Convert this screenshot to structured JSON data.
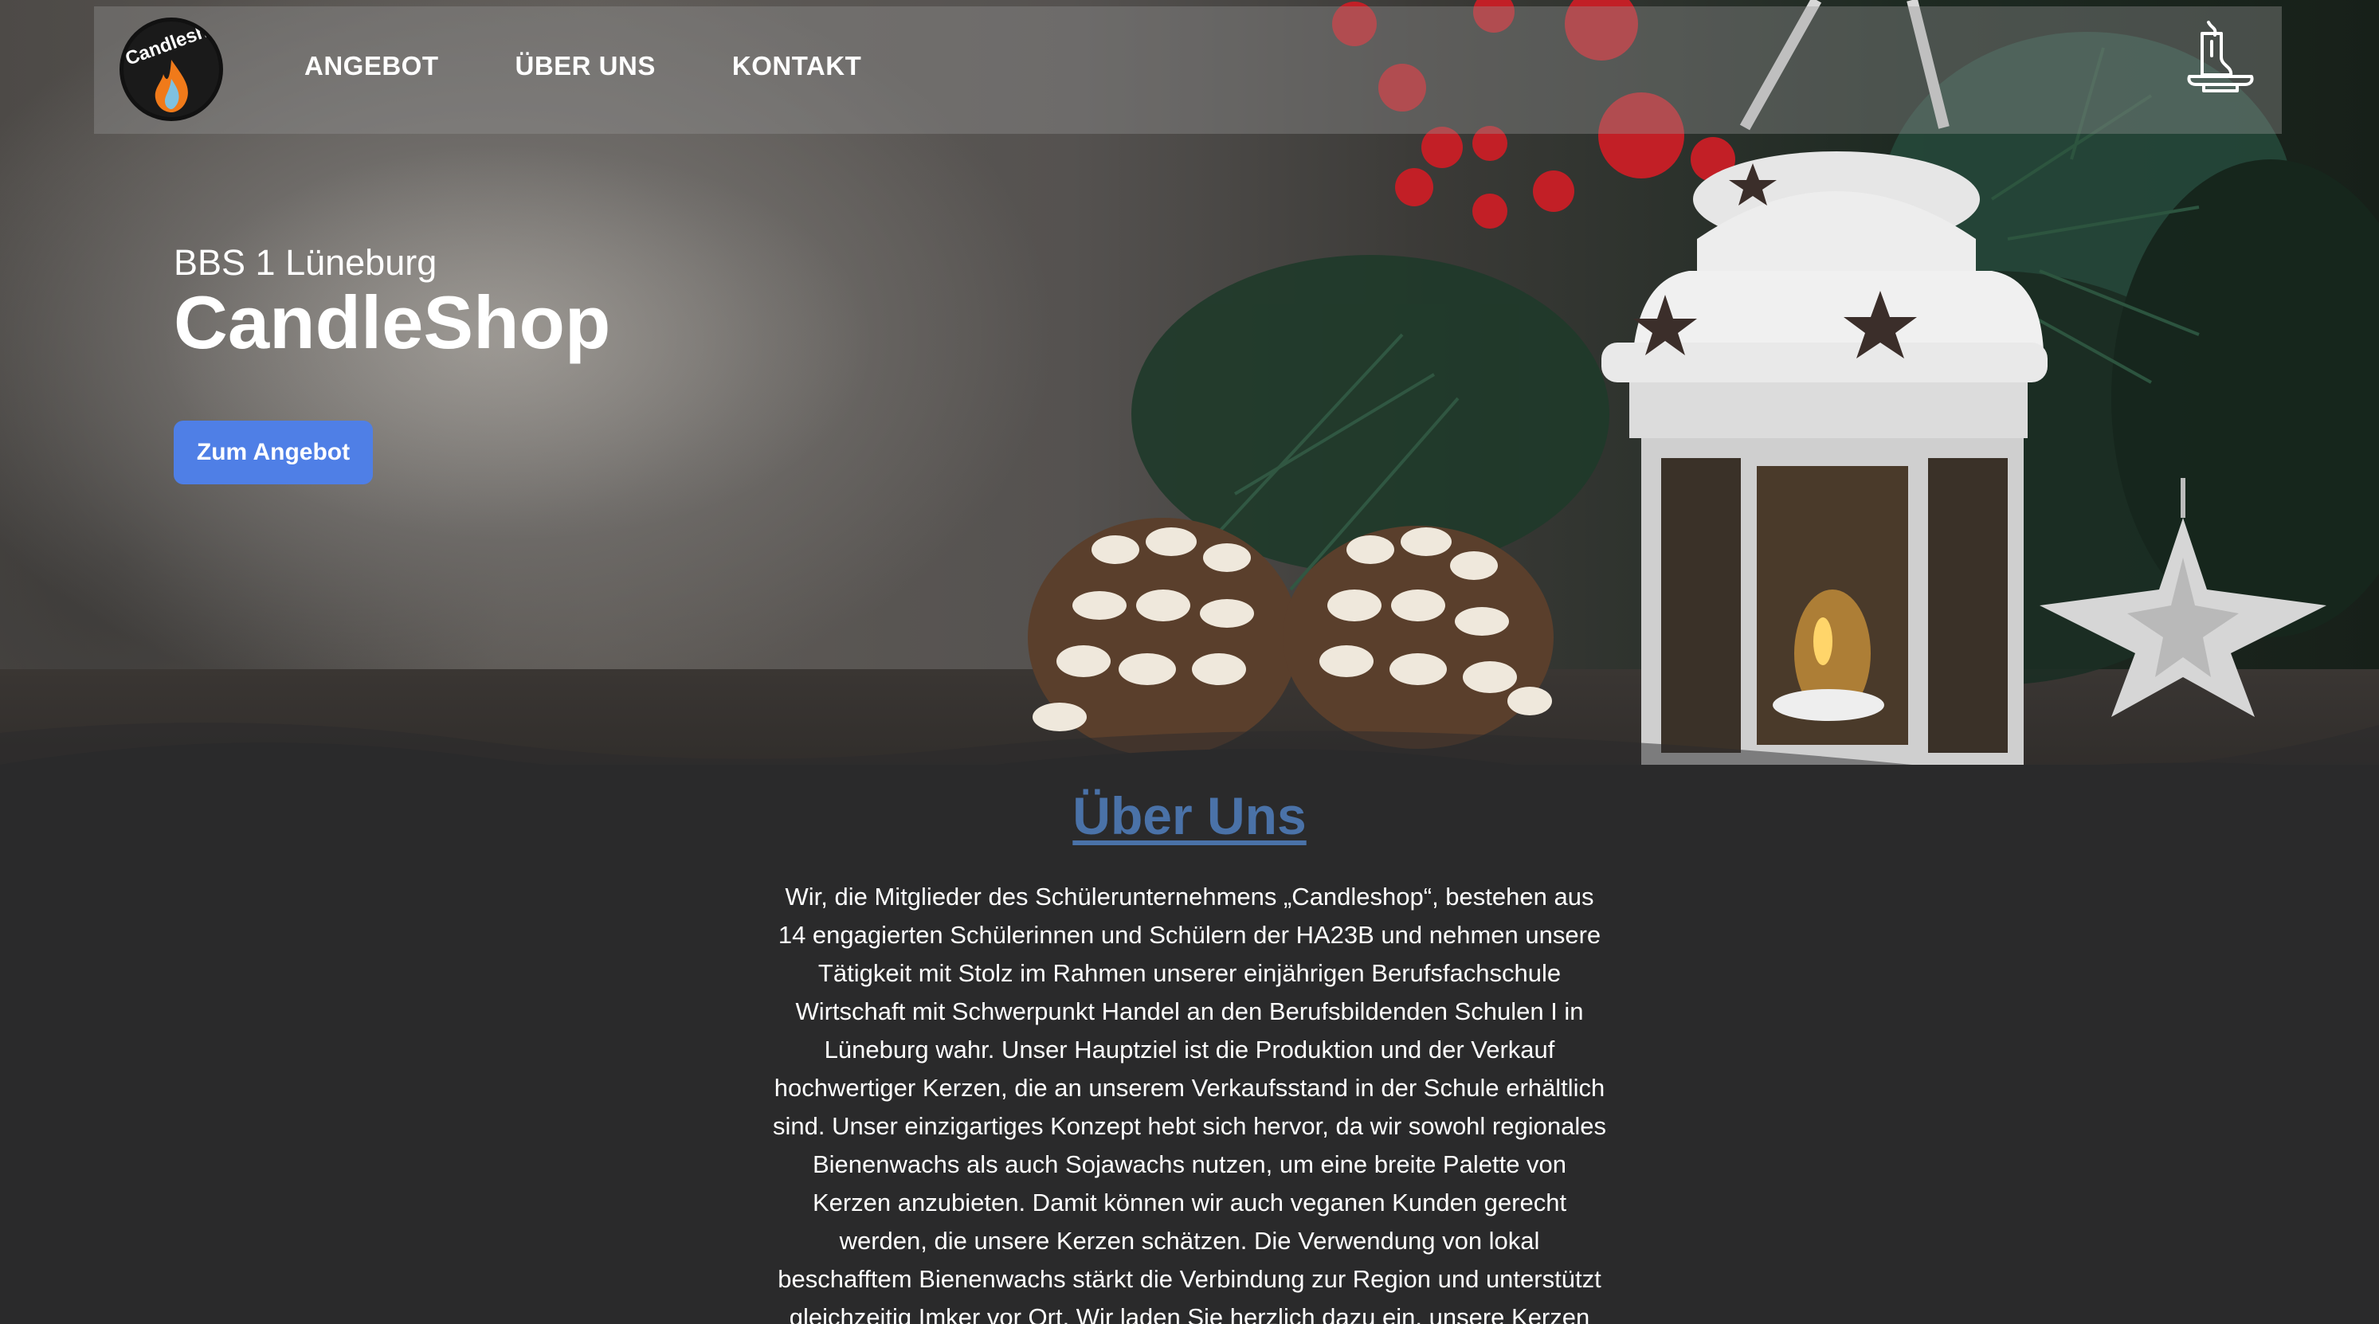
{
  "nav": {
    "logo_text": "Candleshop",
    "links": [
      "ANGEBOT",
      "ÜBER UNS",
      "KONTAKT"
    ]
  },
  "hero": {
    "subtitle": "BBS 1 Lüneburg",
    "title": "CandleShop",
    "cta_label": "Zum Angebot"
  },
  "about": {
    "title": "Über Uns",
    "text": "Wir, die Mitglieder des Schülerunternehmens „Candleshop“, bestehen aus 14 engagierten Schülerinnen und Schülern der HA23B und nehmen unsere Tätigkeit mit Stolz im Rahmen unserer einjährigen Berufsfachschule Wirtschaft mit Schwerpunkt Handel an den Berufsbildenden Schulen I in Lüneburg wahr. Unser Hauptziel ist die Produktion und der Verkauf hochwertiger Kerzen, die an unserem Verkaufsstand in der Schule erhältlich sind. Unser einzigartiges Konzept hebt sich hervor, da wir sowohl regionales Bienenwachs als auch Sojawachs nutzen, um eine breite Palette von Kerzen anzubieten. Damit können wir auch veganen Kunden gerecht werden, die unsere Kerzen schätzen. Die Verwendung von lokal beschafftem Bienenwachs stärkt die Verbindung zur Region und unterstützt gleichzeitig Imker vor Ort. Wir laden Sie herzlich dazu ein, unsere Kerzen und unsere Philosophie"
  },
  "colors": {
    "accent_button": "#4f7fe6",
    "section_title": "#4a72a8",
    "background_dark": "#2a2a2b"
  },
  "icons": {
    "cart": "candle-icon",
    "logo": "flame-logo"
  }
}
